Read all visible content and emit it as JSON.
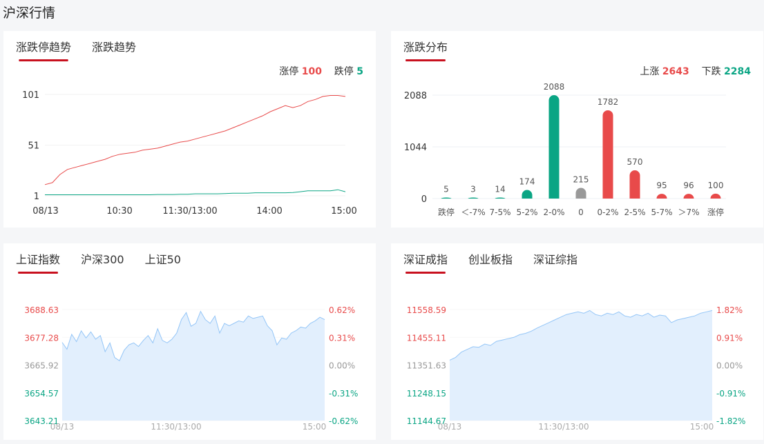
{
  "page_title": "沪深行情",
  "colors": {
    "up": "#e84a4a",
    "down": "#0aa584",
    "flat": "#999999",
    "area": "#e2effd",
    "area_line": "#93c5f7",
    "accent": "#c8101e"
  },
  "panel_limit": {
    "tabs": [
      {
        "label": "涨跌停趋势",
        "active": true
      },
      {
        "label": "涨跌趋势",
        "active": false
      }
    ],
    "limit_up_label": "涨停",
    "limit_up_value": "100",
    "limit_down_label": "跌停",
    "limit_down_value": "5"
  },
  "panel_dist": {
    "tabs": [
      {
        "label": "涨跌分布",
        "active": true
      }
    ],
    "up_label": "上涨",
    "up_value": "2643",
    "down_label": "下跌",
    "down_value": "2284"
  },
  "panel_sh": {
    "tabs": [
      {
        "label": "上证指数",
        "active": true
      },
      {
        "label": "沪深300",
        "active": false
      },
      {
        "label": "上证50",
        "active": false
      }
    ]
  },
  "panel_sz": {
    "tabs": [
      {
        "label": "深证成指",
        "active": true
      },
      {
        "label": "创业板指",
        "active": false
      },
      {
        "label": "深证综指",
        "active": false
      }
    ]
  },
  "chart_data": [
    {
      "type": "line",
      "title": "涨跌停趋势",
      "yticks": [
        "101",
        "51",
        "1"
      ],
      "ylim": [
        1,
        101
      ],
      "xticks": [
        "08/13",
        "10:30",
        "11:30/13:00",
        "14:00",
        "15:00"
      ],
      "series": [
        {
          "name": "涨停",
          "color": "up",
          "values": [
            12,
            14,
            22,
            27,
            29,
            31,
            33,
            35,
            37,
            40,
            42,
            43,
            44,
            46,
            47,
            48,
            50,
            52,
            54,
            55,
            57,
            59,
            61,
            63,
            65,
            68,
            71,
            74,
            77,
            80,
            84,
            87,
            90,
            88,
            90,
            94,
            96,
            99,
            100,
            100,
            99
          ]
        },
        {
          "name": "跌停",
          "color": "down",
          "values": [
            2,
            2,
            2,
            2,
            2,
            2,
            2,
            2,
            2,
            2,
            2,
            2,
            2,
            2,
            2,
            2.3,
            2.3,
            2.3,
            2.5,
            2.5,
            3,
            3,
            3,
            3,
            3.2,
            3.5,
            3.5,
            3.5,
            4,
            4,
            4,
            4,
            4,
            4.2,
            5,
            6,
            6,
            6,
            6,
            7,
            5
          ]
        }
      ]
    },
    {
      "type": "bar",
      "title": "涨跌分布",
      "yticks": [
        "2088",
        "1044",
        "0"
      ],
      "ylim": [
        0,
        2088
      ],
      "categories": [
        "跌停",
        "<-7%",
        "7-5%",
        "5-2%",
        "2-0%",
        "0",
        "0-2%",
        "2-5%",
        "5-7%",
        ">7%",
        "涨停"
      ],
      "display_categories": [
        "跌停",
        "＜-7%",
        "7-5%",
        "5-2%",
        "2-0%",
        "0",
        "0-2%",
        "2-5%",
        "5-7%",
        "＞7%",
        "涨停"
      ],
      "values": [
        5,
        3,
        14,
        174,
        2088,
        215,
        1782,
        570,
        95,
        96,
        100
      ],
      "value_labels": [
        "5",
        "3",
        "14",
        "174",
        "2088",
        "215",
        "1782",
        "570",
        "95",
        "96",
        "100"
      ],
      "colors": [
        "down",
        "down",
        "down",
        "down",
        "down",
        "flat",
        "up",
        "up",
        "up",
        "up",
        "up"
      ]
    },
    {
      "type": "area",
      "title": "上证指数",
      "ylim": [
        3643.21,
        3688.63
      ],
      "yticks_left": [
        "3688.63",
        "3677.28",
        "3665.92",
        "3654.57",
        "3643.21"
      ],
      "yticks_right": [
        "0.62%",
        "0.31%",
        "0.00%",
        "-0.31%",
        "-0.62%"
      ],
      "xticks": [
        "08/13",
        "11:30/13:00",
        "15:00"
      ],
      "values": [
        3675.2,
        3672.4,
        3678.5,
        3675.5,
        3679.9,
        3677,
        3679.5,
        3676.5,
        3678,
        3671.4,
        3675,
        3669,
        3667.7,
        3672,
        3674.2,
        3675,
        3673.5,
        3676,
        3678,
        3675,
        3680.8,
        3676,
        3675,
        3676.5,
        3679,
        3684.6,
        3687.4,
        3681.8,
        3683,
        3687.9,
        3684.5,
        3683,
        3686,
        3679,
        3683,
        3682,
        3683,
        3684,
        3683.5,
        3686,
        3685,
        3685.5,
        3686,
        3682,
        3680,
        3674.2,
        3677,
        3676.5,
        3679,
        3680,
        3681.5,
        3681,
        3683,
        3684,
        3685.5,
        3684.5
      ]
    },
    {
      "type": "area",
      "title": "深证成指",
      "ylim": [
        11144.67,
        11558.59
      ],
      "yticks_left": [
        "11558.59",
        "11455.11",
        "11351.63",
        "11248.15",
        "11144.67"
      ],
      "yticks_right": [
        "1.82%",
        "0.91%",
        "0.00%",
        "-0.91%",
        "-1.82%"
      ],
      "xticks": [
        "08/13",
        "11:30/13:00",
        "15:00"
      ],
      "values": [
        11370,
        11380,
        11400,
        11410,
        11420,
        11418,
        11430,
        11425,
        11440,
        11445,
        11450,
        11455,
        11465,
        11470,
        11478,
        11490,
        11500,
        11510,
        11520,
        11530,
        11540,
        11545,
        11550,
        11545,
        11555,
        11540,
        11535,
        11545,
        11540,
        11550,
        11535,
        11530,
        11540,
        11535,
        11545,
        11530,
        11538,
        11535,
        11510,
        11520,
        11525,
        11530,
        11535,
        11545,
        11550,
        11555
      ]
    }
  ]
}
